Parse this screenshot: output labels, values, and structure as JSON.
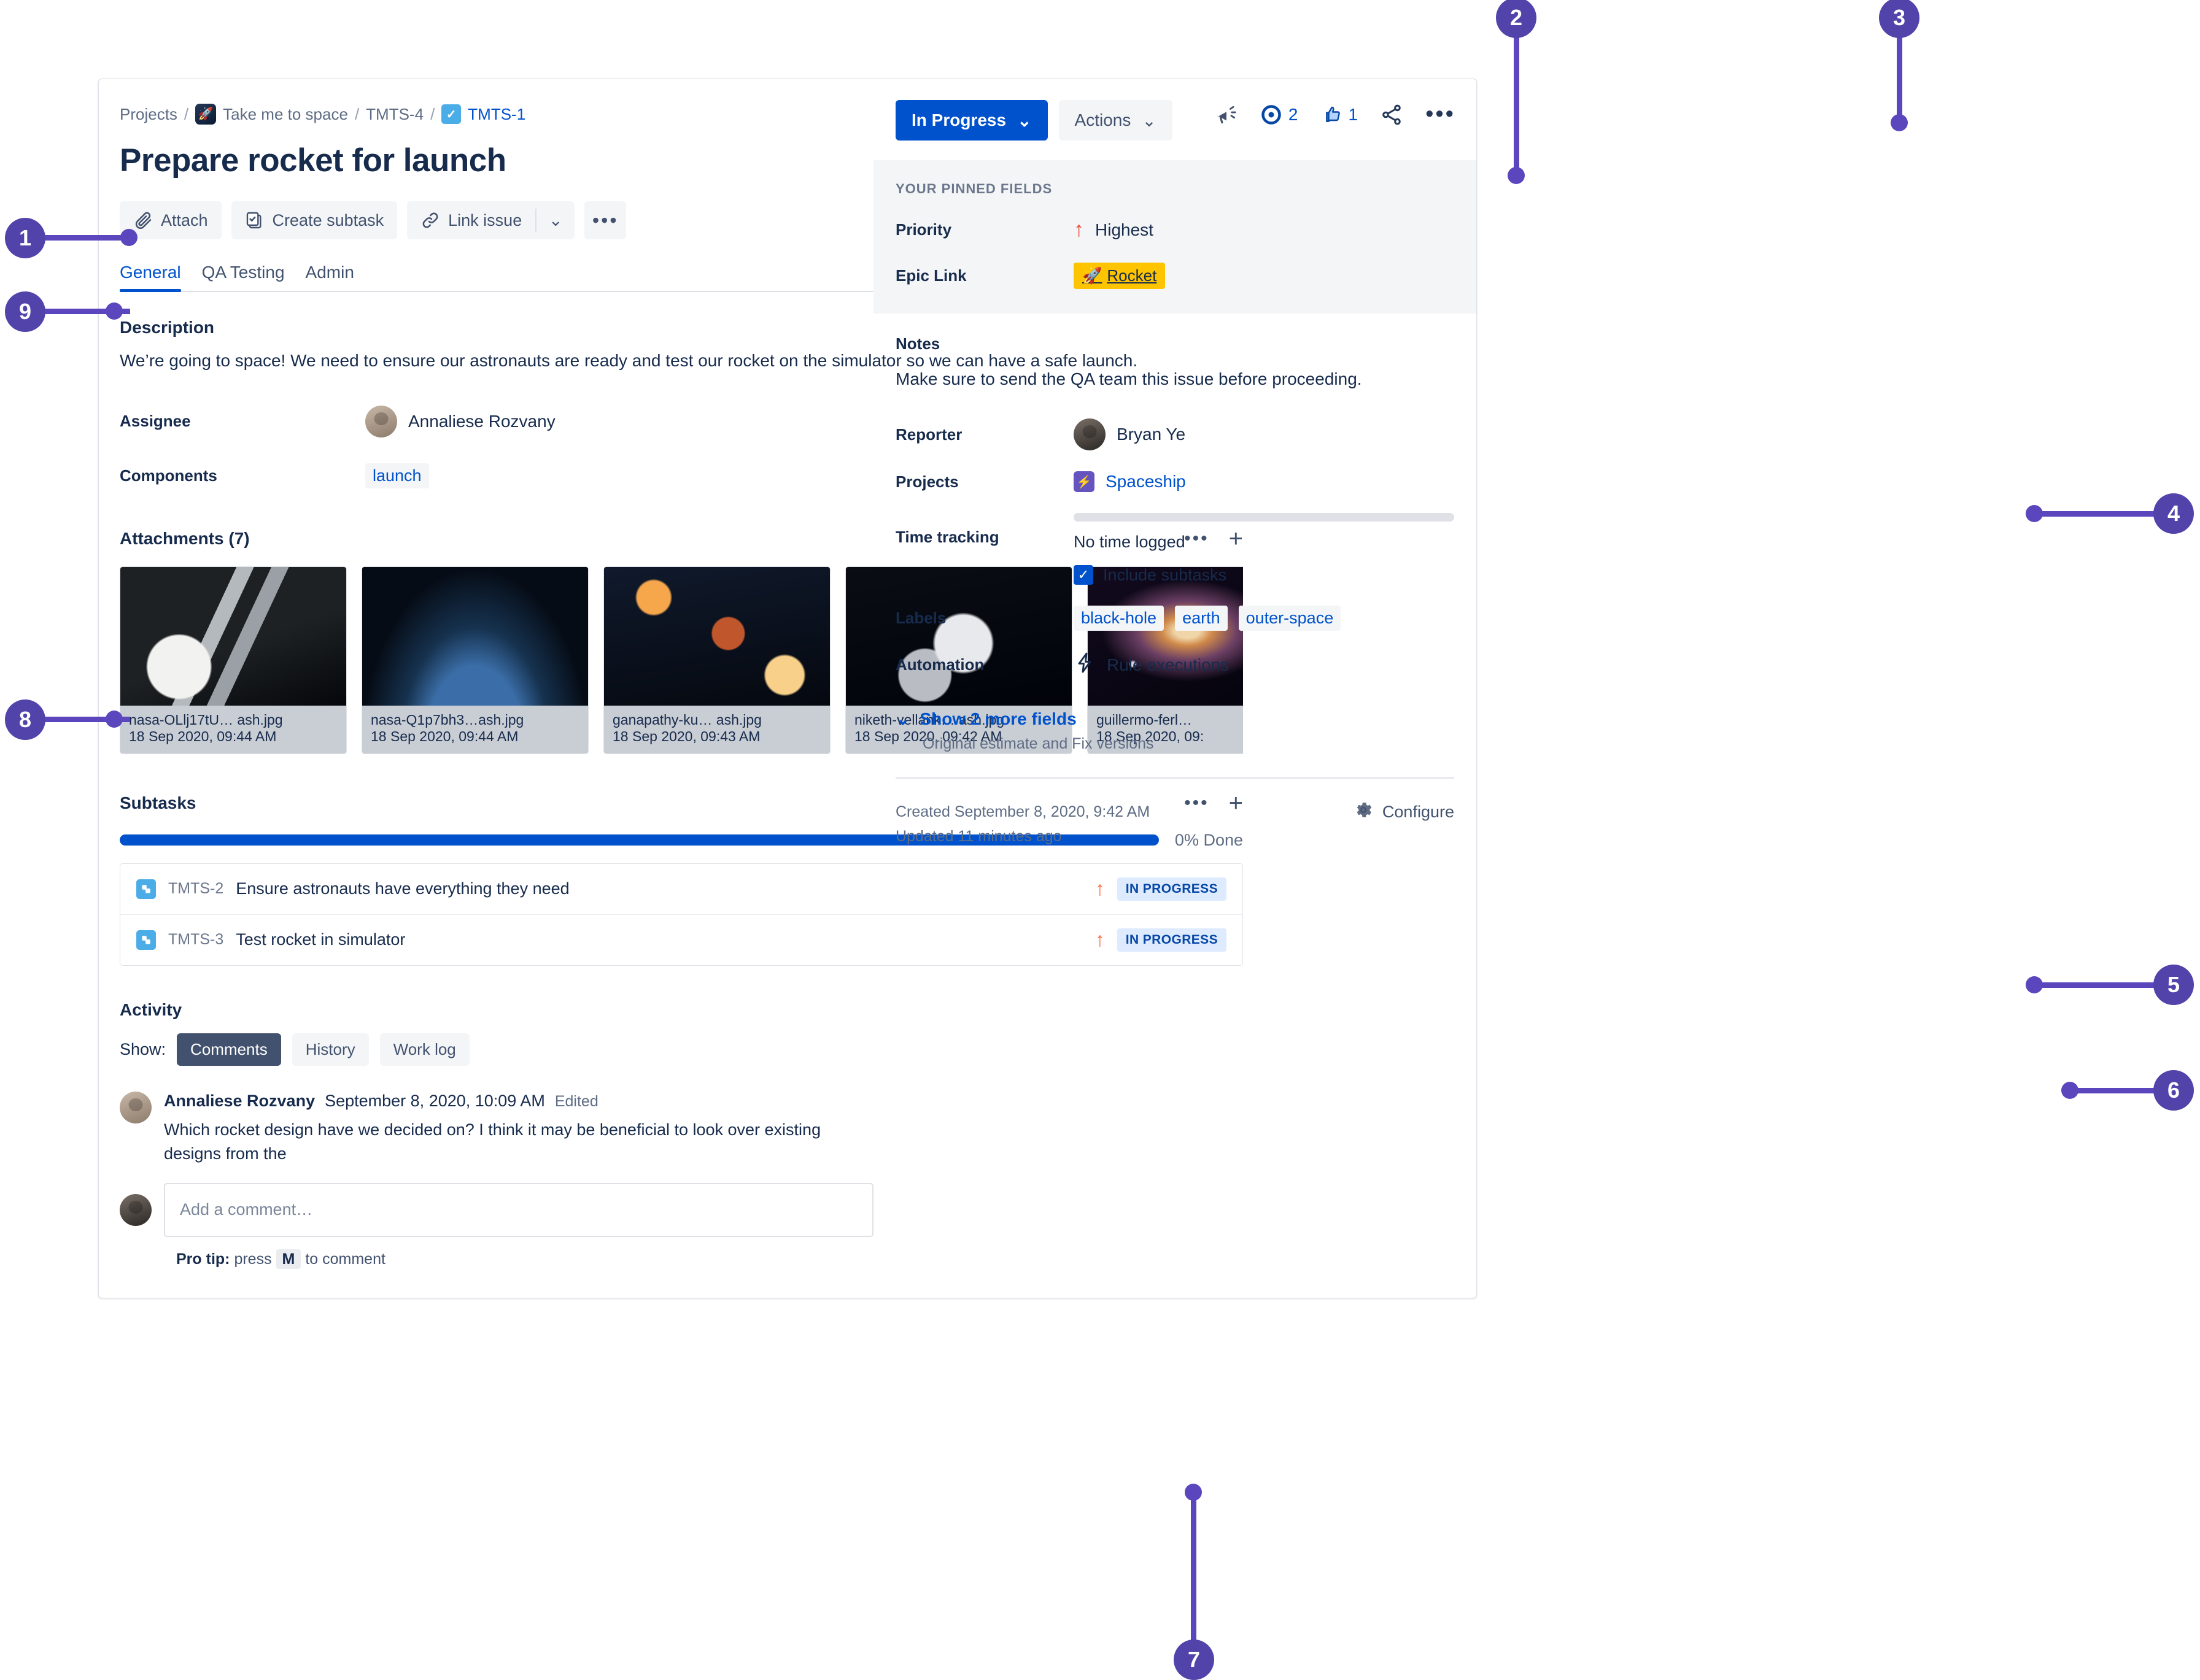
{
  "breadcrumb": {
    "projects": "Projects",
    "project_name": "Take me to space",
    "parent_key": "TMTS-4",
    "issue_key": "TMTS-1",
    "sep": "/"
  },
  "page_title": "Prepare rocket for launch",
  "action_bar": {
    "attach": "Attach",
    "create_subtask": "Create subtask",
    "link_issue": "Link issue",
    "caret": "⌄",
    "more": "•••"
  },
  "tabs": [
    {
      "label": "General",
      "active": true
    },
    {
      "label": "QA Testing",
      "active": false
    },
    {
      "label": "Admin",
      "active": false
    }
  ],
  "description": {
    "heading": "Description",
    "text": "We’re going to space! We need to ensure our astronauts are ready and test our rocket on the simulator so we can have a safe launch."
  },
  "fields": {
    "assignee_label": "Assignee",
    "assignee_value": "Annaliese Rozvany",
    "components_label": "Components",
    "components_value": "launch"
  },
  "attachments": {
    "heading": "Attachments (7)",
    "more_icon": "•••",
    "add_icon": "+",
    "items": [
      {
        "name": "nasa-OLlj17tU… ash.jpg",
        "date": "18 Sep 2020, 09:44 AM",
        "thumb": "astronaut-solar-panel"
      },
      {
        "name": "nasa-Q1p7bh3…ash.jpg",
        "date": "18 Sep 2020, 09:44 AM",
        "thumb": "earth-at-night"
      },
      {
        "name": "ganapathy-ku… ash.jpg",
        "date": "18 Sep 2020, 09:43 AM",
        "thumb": "lunar-eclipse"
      },
      {
        "name": "niketh-vellank… ash.jpg",
        "date": "18 Sep 2020, 09:42 AM",
        "thumb": "astronaut-suit"
      },
      {
        "name": "guillermo-ferl…",
        "date": "18 Sep 2020, 09:",
        "thumb": "galaxy"
      }
    ]
  },
  "subtasks": {
    "heading": "Subtasks",
    "more_icon": "•••",
    "add_icon": "+",
    "progress_label": "0% Done",
    "progress_percent": 100,
    "rows": [
      {
        "key": "TMTS-2",
        "summary": "Ensure astronauts have everything they need",
        "priority": "↑",
        "status": "IN PROGRESS"
      },
      {
        "key": "TMTS-3",
        "summary": "Test rocket in simulator",
        "priority": "↑",
        "status": "IN PROGRESS"
      }
    ]
  },
  "activity": {
    "heading": "Activity",
    "show_label": "Show:",
    "segments": [
      {
        "label": "Comments",
        "active": true
      },
      {
        "label": "History",
        "active": false
      },
      {
        "label": "Work log",
        "active": false
      }
    ],
    "comment": {
      "author": "Annaliese Rozvany",
      "timestamp": "September 8, 2020, 10:09 AM",
      "edited": "Edited",
      "text": "Which rocket design have we decided on? I think it may be beneficial to look over existing designs from the"
    },
    "comment_input_placeholder": "Add a comment…",
    "protip_prefix": "Pro tip:",
    "protip_press": "press",
    "protip_key": "M",
    "protip_suffix": "to comment"
  },
  "header_icons": {
    "feedback": "feedback-megaphone-icon",
    "watch_count": "2",
    "like_count": "1",
    "share": "share-icon",
    "more": "•••"
  },
  "right_panel": {
    "status_button": "In Progress",
    "status_caret": "⌄",
    "actions_button": "Actions",
    "actions_caret": "⌄",
    "pinned_title": "YOUR PINNED FIELDS",
    "priority_label": "Priority",
    "priority_value": "Highest",
    "priority_icon": "↑",
    "epic_label": "Epic Link",
    "epic_value": "Rocket",
    "epic_icon": "🚀",
    "notes_label": "Notes",
    "notes_text": "Make sure to send the QA team this issue before proceeding.",
    "reporter_label": "Reporter",
    "reporter_value": "Bryan Ye",
    "projects_label": "Projects",
    "projects_value": "Spaceship",
    "time_tracking_label": "Time tracking",
    "time_tracking_value": "No time logged",
    "include_subtasks_label": "Include subtasks",
    "include_subtasks_checked": true,
    "labels_label": "Labels",
    "labels_values": [
      "black-hole",
      "earth",
      "outer-space"
    ],
    "automation_label": "Automation",
    "automation_value": "Rule executions",
    "show_more_fields": "Show 2 more fields",
    "show_more_sub": "Original estimate and Fix versions",
    "created": "Created September 8, 2020, 9:42 AM",
    "updated": "Updated 11 minutes ago",
    "configure": "Configure"
  },
  "callouts": [
    {
      "n": "1"
    },
    {
      "n": "2"
    },
    {
      "n": "3"
    },
    {
      "n": "4"
    },
    {
      "n": "5"
    },
    {
      "n": "6"
    },
    {
      "n": "7"
    },
    {
      "n": "8"
    },
    {
      "n": "9"
    }
  ],
  "colors": {
    "accent_blue": "#0052CC",
    "callout_purple": "#5243AA",
    "epic_yellow": "#FFC400",
    "priority_red": "#E5493A",
    "subtask_orange": "#FF7043"
  }
}
